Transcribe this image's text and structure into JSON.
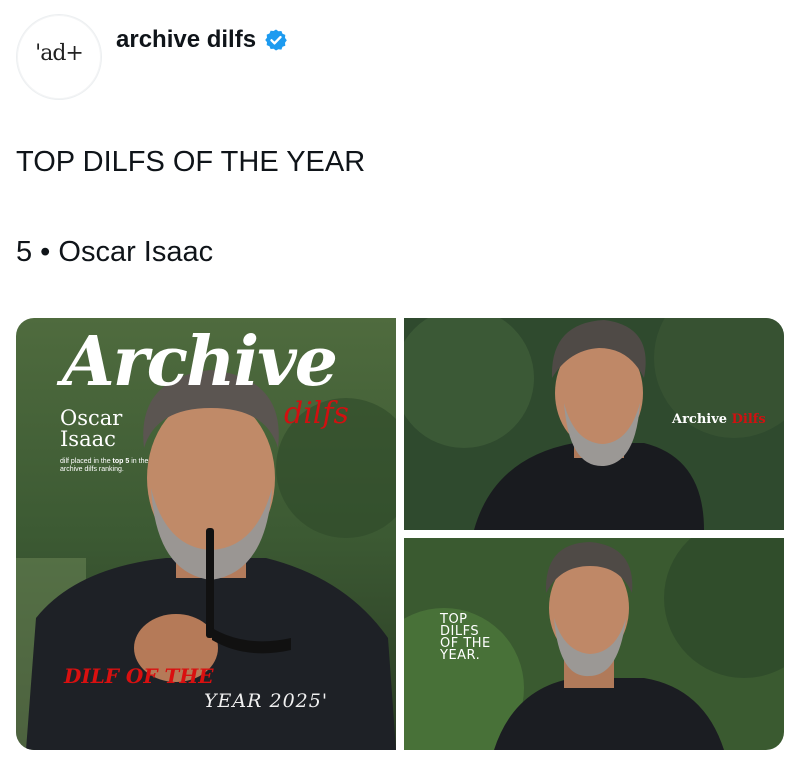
{
  "account": {
    "avatar_text": "'ad+",
    "display_name": "archive dilfs",
    "verified": true,
    "verified_color": "#1d9bf0"
  },
  "tweet": {
    "line1": "TOP DILFS OF THE YEAR",
    "line2": "5 • Oscar Isaac"
  },
  "media": {
    "main": {
      "title": "Archive",
      "subtitle": "dilfs",
      "name": "Oscar\nIsaac",
      "blurb_pre": "dilf placed in the ",
      "blurb_bold": "top 5",
      "blurb_post": " in the archive dilfs ranking.",
      "banner_red": "DILF OF THE",
      "banner_year": "YEAR 2025'"
    },
    "top_right": {
      "brand_left": "Archive",
      "brand_right": "Dilfs"
    },
    "bottom_right": {
      "overlay": "TOP\nDILFS\nOF THE\nYEAR."
    }
  }
}
